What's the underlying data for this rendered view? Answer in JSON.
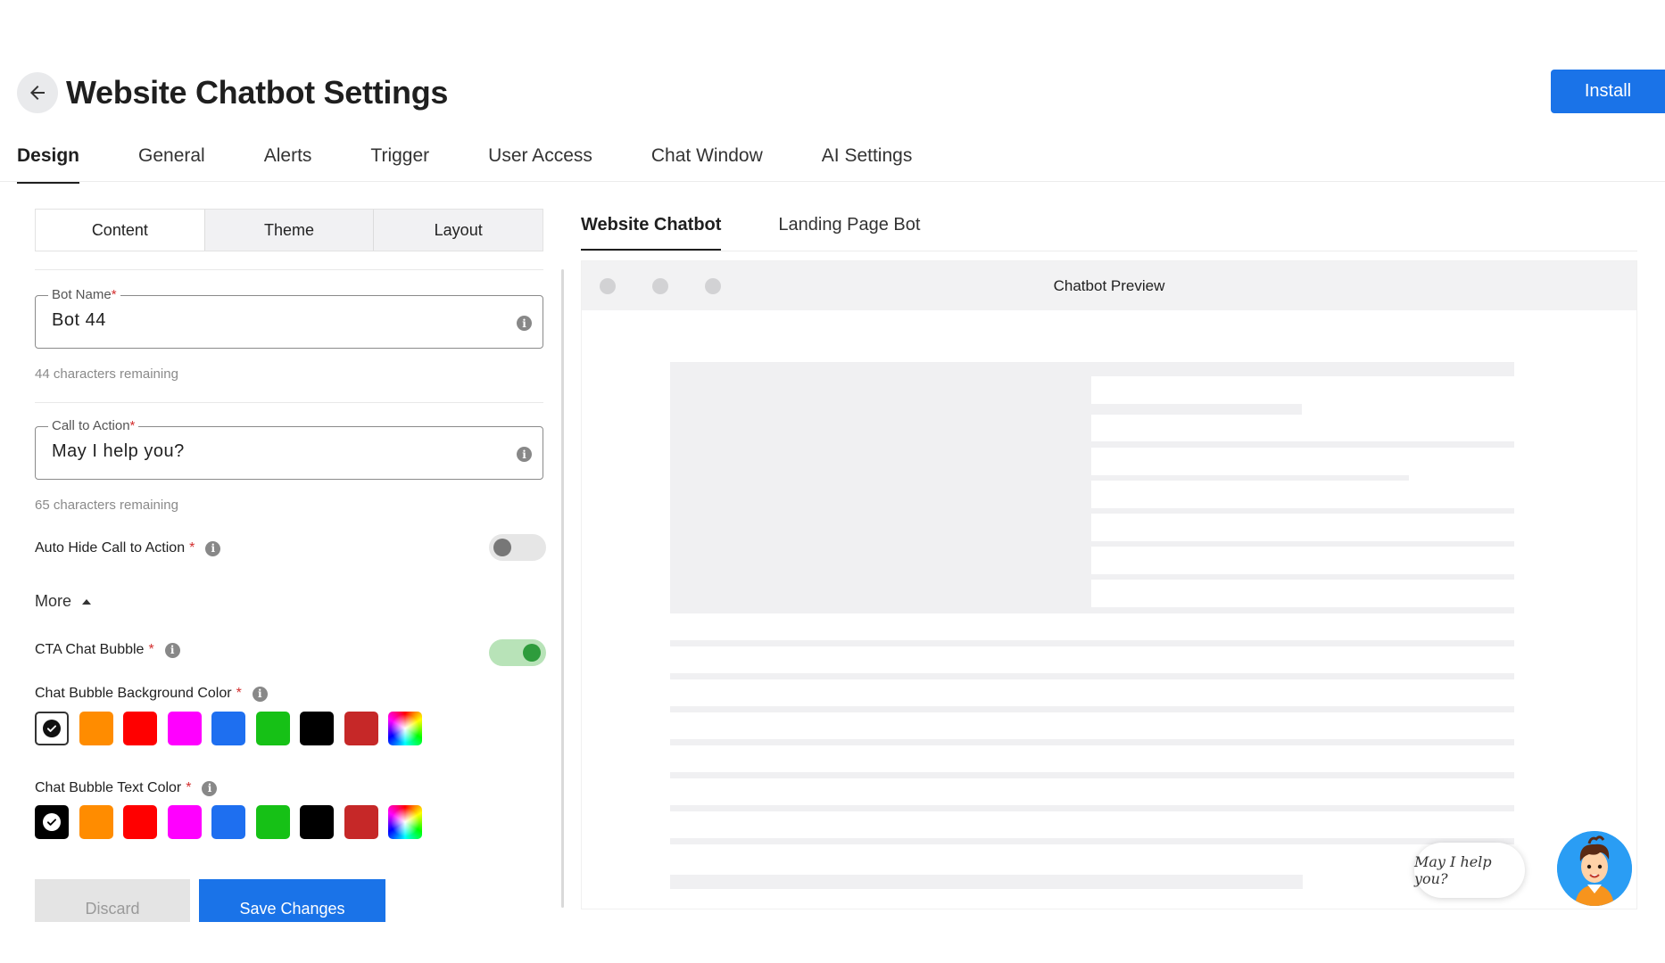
{
  "header": {
    "title": "Website Chatbot Settings",
    "install_label": "Install"
  },
  "main_tabs": [
    {
      "label": "Design",
      "active": true
    },
    {
      "label": "General"
    },
    {
      "label": "Alerts"
    },
    {
      "label": "Trigger"
    },
    {
      "label": "User Access"
    },
    {
      "label": "Chat Window"
    },
    {
      "label": "AI Settings"
    }
  ],
  "sub_tabs": [
    {
      "label": "Content",
      "active": true
    },
    {
      "label": "Theme"
    },
    {
      "label": "Layout"
    }
  ],
  "form": {
    "bot_name": {
      "label": "Bot Name",
      "required_mark": "*",
      "value": "Bot 44",
      "hint": "44 characters remaining"
    },
    "call_to_action": {
      "label": "Call to Action",
      "required_mark": "*",
      "value": "May I help you?",
      "hint": "65 characters remaining"
    },
    "auto_hide": {
      "label": "Auto Hide Call to Action",
      "required_mark": "*",
      "enabled": false
    },
    "more_label": "More",
    "cta_bubble": {
      "label": "CTA Chat Bubble",
      "required_mark": "*",
      "enabled": true
    },
    "bubble_bg_color": {
      "label": "Chat Bubble Background Color",
      "required_mark": "*",
      "selected": "#ffffff"
    },
    "bubble_text_color": {
      "label": "Chat Bubble Text Color",
      "required_mark": "*",
      "selected": "#000000"
    },
    "palette": [
      "#ff8c00",
      "#ff0000",
      "#ff00ff",
      "#1e6ff0",
      "#16c116",
      "#000000",
      "#c62828"
    ],
    "discard_label": "Discard",
    "save_label": "Save Changes"
  },
  "preview": {
    "tabs": [
      {
        "label": "Website Chatbot",
        "active": true
      },
      {
        "label": "Landing Page Bot"
      }
    ],
    "title": "Chatbot Preview",
    "bubble_text": "May I help you?"
  },
  "colors": {
    "primary": "#1a73e8",
    "toggle_on": "#2e9c3c",
    "required": "#d32f2f"
  }
}
